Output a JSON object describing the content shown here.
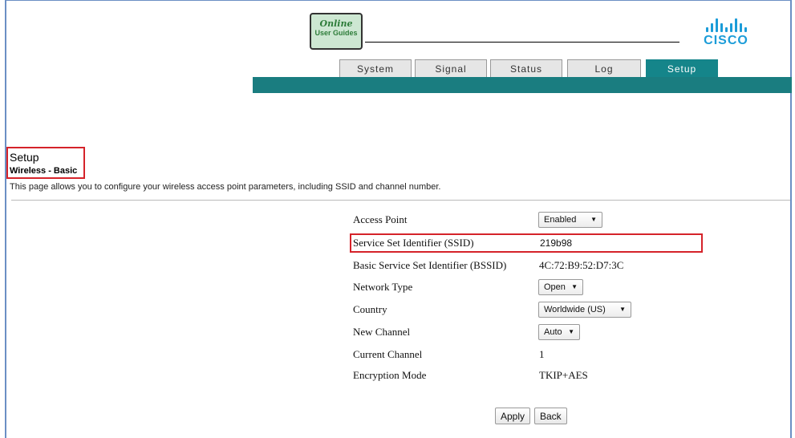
{
  "header": {
    "guide_line1": "Online",
    "guide_line2": "User Guides",
    "brand": "CISCO",
    "brand_color": "#1b9cd8",
    "tabs": [
      {
        "label": "System"
      },
      {
        "label": "Signal"
      },
      {
        "label": "Status"
      },
      {
        "label": "Log"
      },
      {
        "label": "Setup",
        "active": true
      }
    ],
    "accent_color": "#1a7d80"
  },
  "page": {
    "title": "Setup",
    "subtitle": "Wireless - Basic",
    "description": "This page allows you to configure your wireless access point parameters, including SSID and channel number."
  },
  "form": {
    "access_point": {
      "label": "Access Point",
      "value": "Enabled"
    },
    "ssid": {
      "label": "Service Set Identifier (SSID)",
      "value": "219b98"
    },
    "bssid": {
      "label": "Basic Service Set Identifier (BSSID)",
      "value": "4C:72:B9:52:D7:3C"
    },
    "network_type": {
      "label": "Network Type",
      "value": "Open"
    },
    "country": {
      "label": "Country",
      "value": "Worldwide (US)"
    },
    "new_channel": {
      "label": "New Channel",
      "value": "Auto"
    },
    "current_channel": {
      "label": "Current Channel",
      "value": "1"
    },
    "encryption_mode": {
      "label": "Encryption Mode",
      "value": "TKIP+AES"
    }
  },
  "buttons": {
    "apply": "Apply",
    "back": "Back"
  },
  "highlight_color": "#d5232a"
}
